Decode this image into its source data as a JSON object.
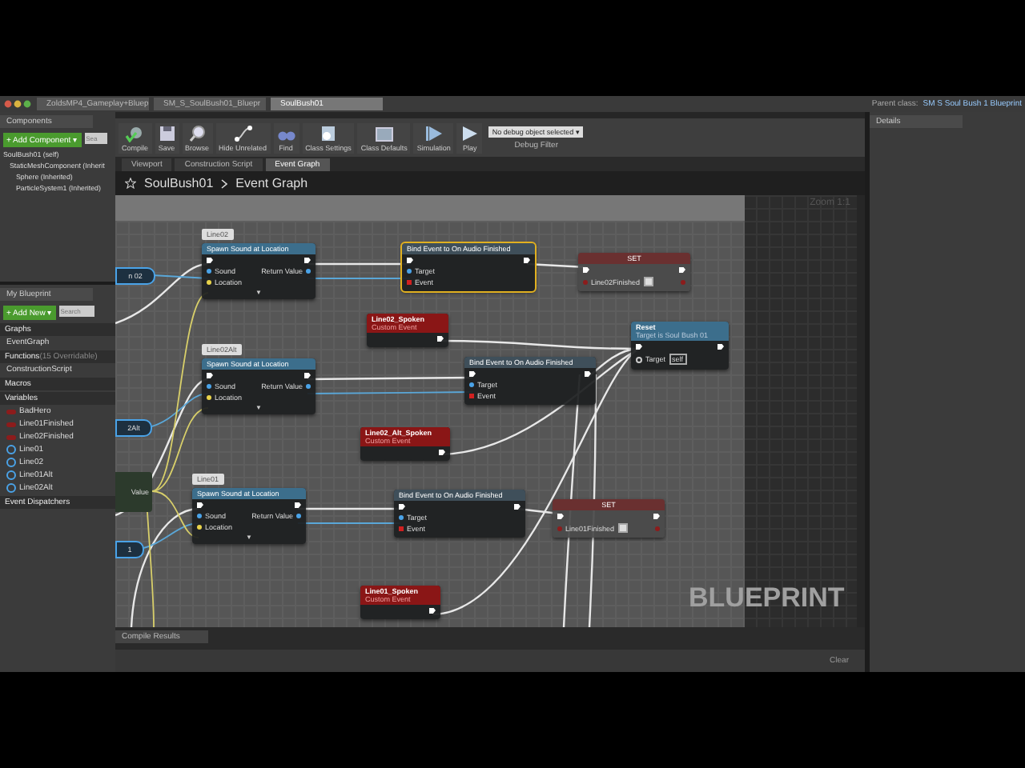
{
  "window_tabs": [
    {
      "label": "ZoldsMP4_Gameplay+Bluep",
      "selected": false
    },
    {
      "label": "SM_S_SoulBush01_Bluepr",
      "selected": false
    },
    {
      "label": "SoulBush01",
      "selected": true
    }
  ],
  "parent_class": {
    "label": "Parent class:",
    "value": "SM S Soul Bush 1 Blueprint"
  },
  "components": {
    "title": "Components",
    "add_button": "+ Add Component ▾",
    "search_placeholder": "Sea",
    "tree": [
      {
        "label": "SoulBush01 (self)",
        "children": [
          {
            "label": "StaticMeshComponent (Inherit",
            "children": [
              {
                "label": "Sphere (Inherited)"
              },
              {
                "label": "ParticleSystem1 (Inherited)"
              }
            ]
          }
        ]
      }
    ]
  },
  "toolbar": [
    {
      "label": "Compile",
      "kind": "compile"
    },
    {
      "label": "Save",
      "kind": "save"
    },
    {
      "label": "Browse",
      "kind": "browse"
    },
    {
      "label": "Hide Unrelated",
      "kind": "hide"
    },
    {
      "label": "Find",
      "kind": "find"
    },
    {
      "label": "Class Settings",
      "kind": "settings"
    },
    {
      "label": "Class Defaults",
      "kind": "defaults"
    },
    {
      "label": "Simulation",
      "kind": "simulation"
    },
    {
      "label": "Play",
      "kind": "play"
    }
  ],
  "debug": {
    "value": "No debug object selected ▾",
    "label": "Debug Filter"
  },
  "editor_tabs": [
    {
      "label": "Viewport",
      "selected": false
    },
    {
      "label": "Construction Script",
      "selected": false
    },
    {
      "label": "Event Graph",
      "selected": true
    }
  ],
  "breadcrumb": [
    "SoulBush01",
    "Event Graph"
  ],
  "zoom": "Zoom 1:1",
  "my_blueprint": {
    "title": "My Blueprint",
    "add_button": "+ Add New ▾",
    "search_placeholder": "Search",
    "sections": [
      {
        "title": "Graphs",
        "items": [
          {
            "label": "EventGraph"
          }
        ]
      },
      {
        "title": "Functions",
        "note": "(15 Overridable)",
        "items": [
          {
            "label": "ConstructionScript"
          }
        ]
      },
      {
        "title": "Macros"
      },
      {
        "title": "Variables",
        "items": [
          {
            "label": "BadHero",
            "kind": "boolean"
          },
          {
            "label": "Line01Finished",
            "kind": "boolean"
          },
          {
            "label": "Line02Finished",
            "kind": "boolean"
          },
          {
            "label": "Line01",
            "kind": "object"
          },
          {
            "label": "Line02",
            "kind": "object"
          },
          {
            "label": "Line01Alt",
            "kind": "object"
          },
          {
            "label": "Line02Alt",
            "kind": "object"
          }
        ]
      },
      {
        "title": "Event Dispatchers"
      }
    ]
  },
  "graph": {
    "nodes": [
      {
        "kind": "getter",
        "label": "n 02"
      },
      {
        "kind": "spawn",
        "comment": "Line02",
        "title": "Spawn Sound at Location",
        "inputs": [
          "Sound",
          "Location"
        ],
        "output": "Return Value",
        "expand": "▼"
      },
      {
        "kind": "bind",
        "title": "Bind Event to On Audio Finished",
        "inputs": [
          "Target",
          "Event"
        ],
        "selected": true
      },
      {
        "kind": "set",
        "title": "SET",
        "variable": "Line02Finished",
        "checked": true
      },
      {
        "kind": "event",
        "title": "Line02_Spoken",
        "subtitle": "Custom Event"
      },
      {
        "kind": "call",
        "title": "Reset",
        "subtitle": "Target is Soul Bush 01",
        "input": "Target",
        "default": "self"
      },
      {
        "kind": "getter",
        "label": "2Alt"
      },
      {
        "kind": "spawn",
        "comment": "Line02Alt",
        "title": "Spawn Sound at Location",
        "inputs": [
          "Sound",
          "Location"
        ],
        "output": "Return Value",
        "expand": "▼"
      },
      {
        "kind": "bind",
        "title": "Bind Event to On Audio Finished",
        "inputs": [
          "Target",
          "Event"
        ],
        "selected": false
      },
      {
        "kind": "event",
        "title": "Line02_Alt_Spoken",
        "subtitle": "Custom Event"
      },
      {
        "kind": "partial",
        "label": "Value"
      },
      {
        "kind": "getter",
        "label": "1"
      },
      {
        "kind": "spawn",
        "comment": "Line01",
        "title": "Spawn Sound at Location",
        "inputs": [
          "Sound",
          "Location"
        ],
        "output": "Return Value",
        "expand": "▼"
      },
      {
        "kind": "bind",
        "title": "Bind Event to On Audio Finished",
        "inputs": [
          "Target",
          "Event"
        ],
        "selected": false
      },
      {
        "kind": "set",
        "title": "SET",
        "variable": "Line01Finished",
        "checked": true
      },
      {
        "kind": "event",
        "title": "Line01_Spoken",
        "subtitle": "Custom Event"
      }
    ],
    "watermark": "BLUEPRINT"
  },
  "details": {
    "title": "Details"
  },
  "compile_results": {
    "title": "Compile Results",
    "clear": "Clear"
  }
}
